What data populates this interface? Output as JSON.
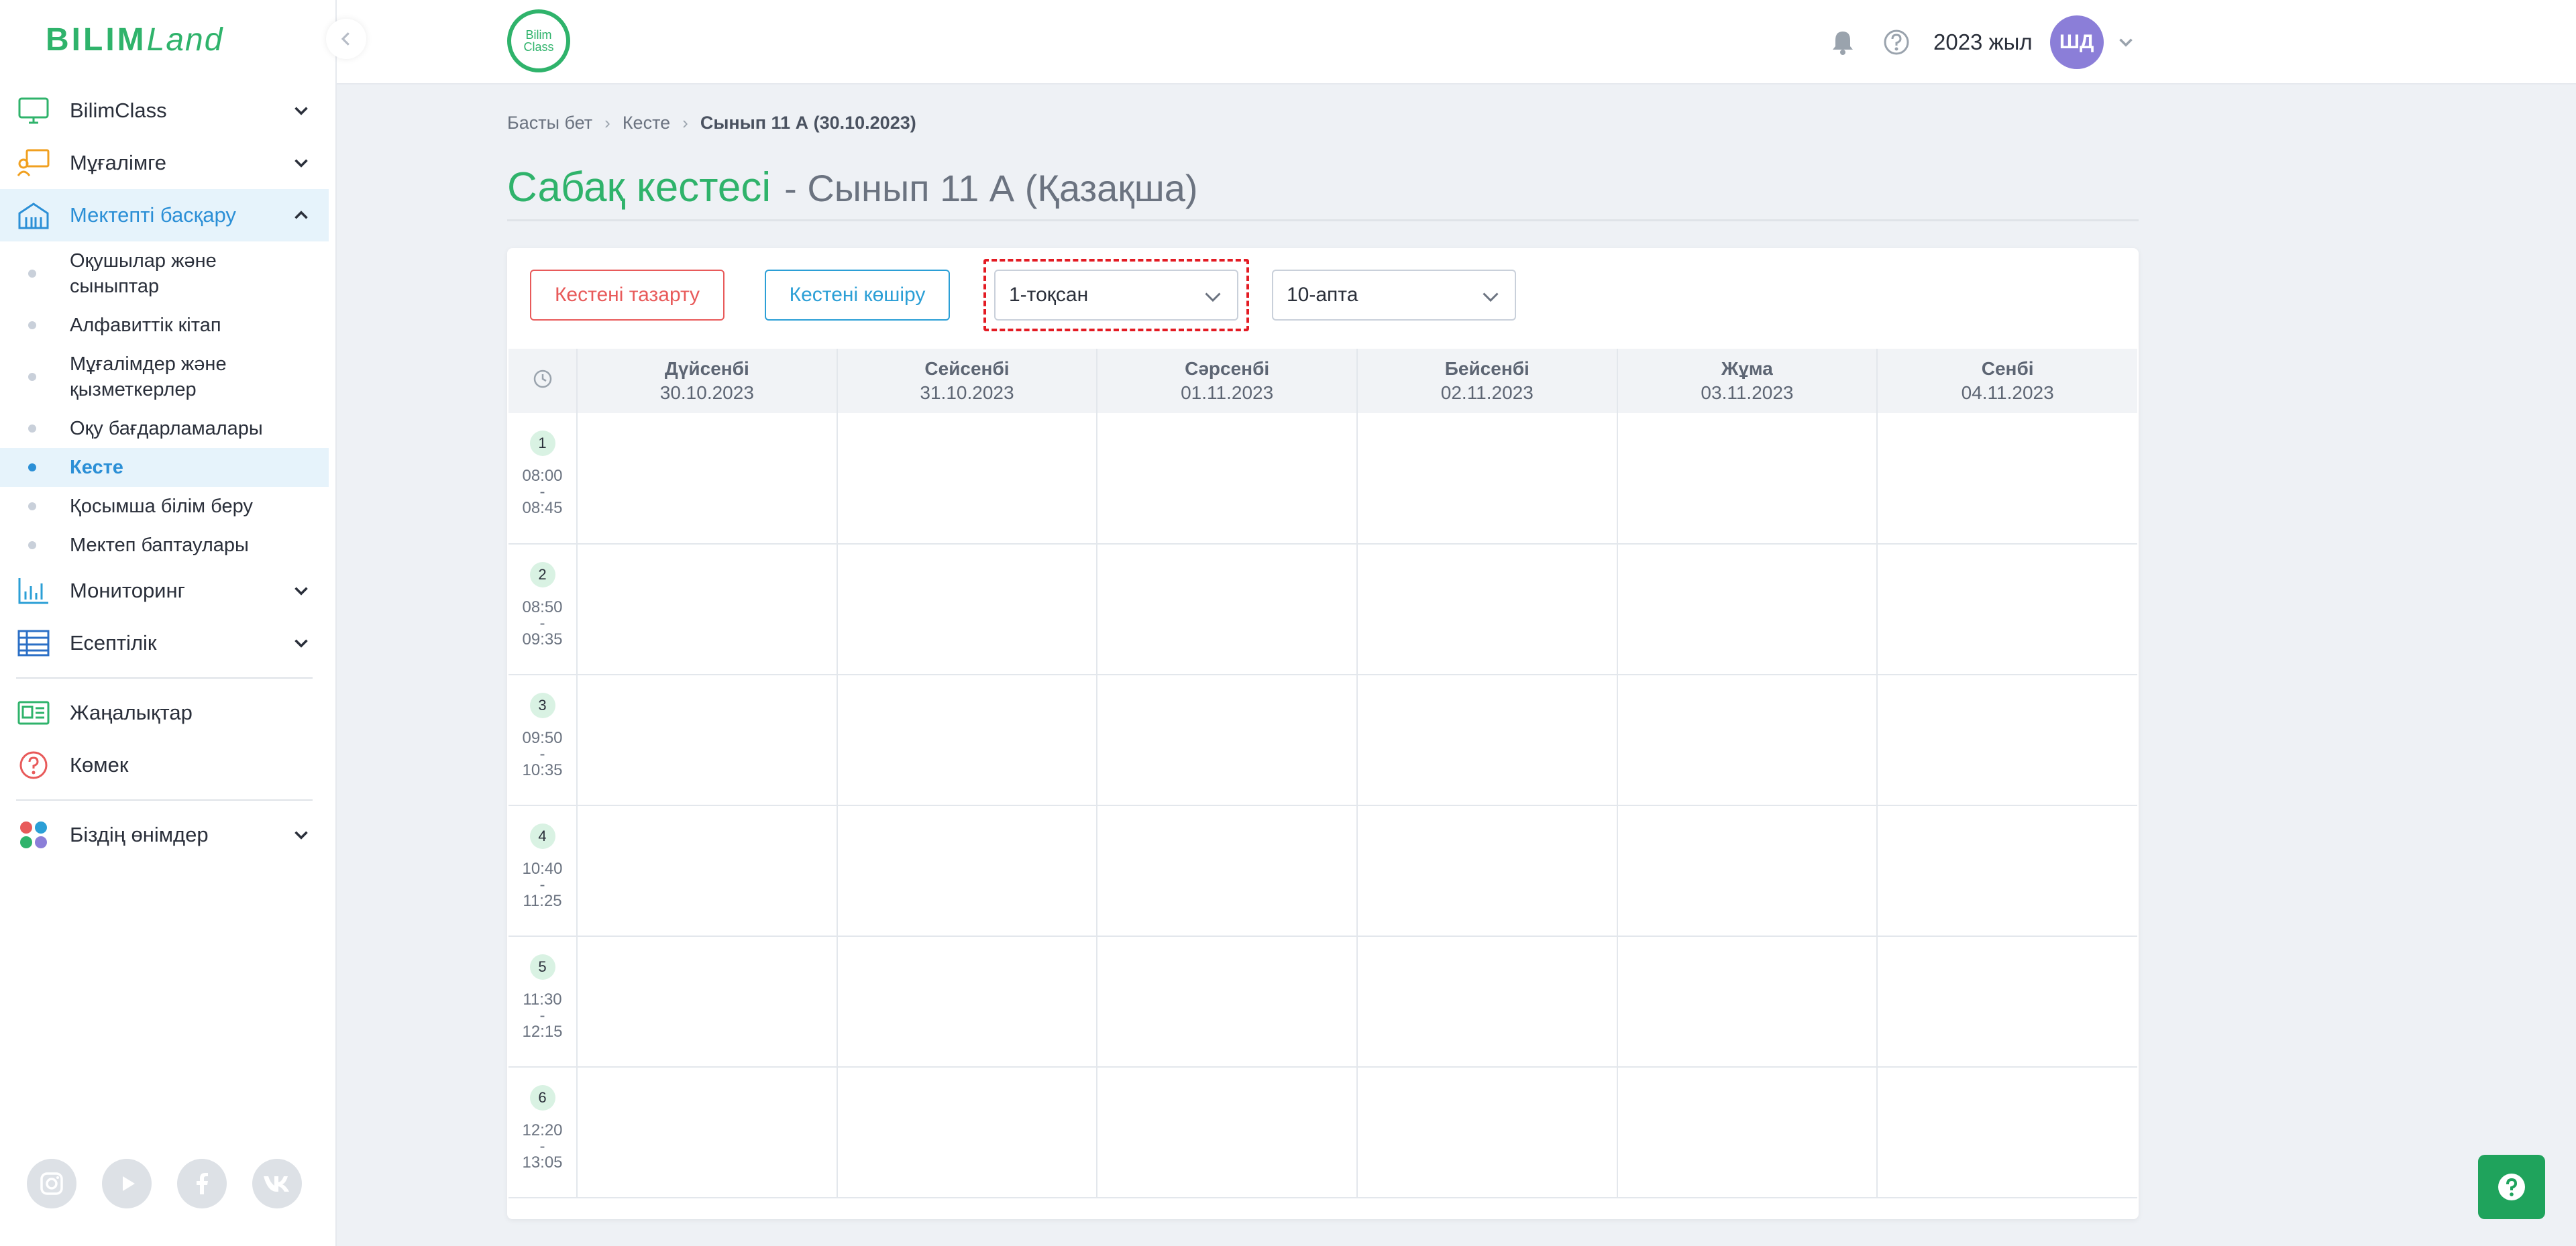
{
  "logo": {
    "main": "BILIM",
    "land": "Land"
  },
  "topbar": {
    "product_logo": "Bilim Class",
    "year": "2023 жыл",
    "avatar_initials": "ШД"
  },
  "sidebar": {
    "items": [
      {
        "label": "BilimClass"
      },
      {
        "label": "Мұғалімге"
      },
      {
        "label": "Мектепті басқару"
      },
      {
        "label": "Мониторинг"
      },
      {
        "label": "Есептілік"
      },
      {
        "label": "Жаңалықтар"
      },
      {
        "label": "Көмек"
      },
      {
        "label": "Біздің өнімдер"
      }
    ],
    "subitems": [
      {
        "label": "Оқушылар және сыныптар"
      },
      {
        "label": "Алфавиттік кітап"
      },
      {
        "label": "Мұғалімдер және қызметкерлер"
      },
      {
        "label": "Оқу бағдарламалары"
      },
      {
        "label": "Кесте"
      },
      {
        "label": "Қосымша білім беру"
      },
      {
        "label": "Мектеп баптаулары"
      }
    ]
  },
  "breadcrumb": {
    "home": "Басты бет",
    "schedule": "Кесте",
    "current": "Сынып 11 А (30.10.2023)"
  },
  "page": {
    "title": "Сабақ кестесі",
    "subtitle": "- Сынып 11 А (Қазақша)"
  },
  "toolbar": {
    "clear_label": "Кестені тазарту",
    "copy_label": "Кестені көшіру",
    "quarter_value": "1-тоқсан",
    "week_value": "10-апта"
  },
  "days": [
    {
      "name": "Дүйсенбі",
      "date": "30.10.2023"
    },
    {
      "name": "Сейсенбі",
      "date": "31.10.2023"
    },
    {
      "name": "Сәрсенбі",
      "date": "01.11.2023"
    },
    {
      "name": "Бейсенбі",
      "date": "02.11.2023"
    },
    {
      "name": "Жұма",
      "date": "03.11.2023"
    },
    {
      "name": "Сенбі",
      "date": "04.11.2023"
    }
  ],
  "slots": [
    {
      "num": "1",
      "start": "08:00",
      "dash": "-",
      "end": "08:45"
    },
    {
      "num": "2",
      "start": "08:50",
      "dash": "-",
      "end": "09:35"
    },
    {
      "num": "3",
      "start": "09:50",
      "dash": "-",
      "end": "10:35"
    },
    {
      "num": "4",
      "start": "10:40",
      "dash": "-",
      "end": "11:25"
    },
    {
      "num": "5",
      "start": "11:30",
      "dash": "-",
      "end": "12:15"
    },
    {
      "num": "6",
      "start": "12:20",
      "dash": "-",
      "end": "13:05"
    }
  ],
  "colors": {
    "brand_green": "#2fb36b",
    "active_blue": "#2b8fd6",
    "danger": "#e85a5a",
    "avatar": "#8b7ed8"
  },
  "icons": {
    "bilimclass": "monitor-icon",
    "teacher": "teacher-icon",
    "school": "school-building-icon",
    "monitoring": "bar-chart-icon",
    "reports": "table-icon",
    "news": "newspaper-icon",
    "help": "question-circle-icon",
    "products": "grid-dots-icon"
  }
}
